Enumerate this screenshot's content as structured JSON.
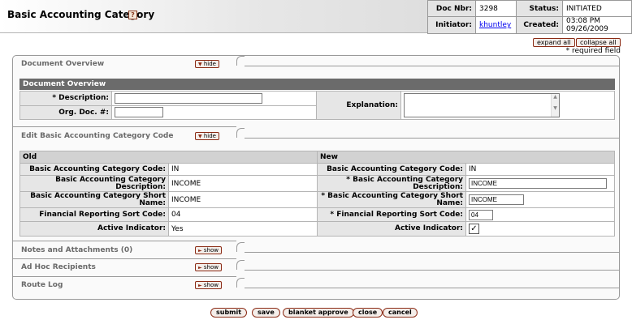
{
  "header": {
    "title": "Basic Accounting Category",
    "help_icon": "?",
    "doc_nbr_label": "Doc Nbr:",
    "doc_nbr": "3298",
    "status_label": "Status:",
    "status": "INITIATED",
    "initiator_label": "Initiator:",
    "initiator": "khuntley",
    "created_label": "Created:",
    "created": "03:08 PM 09/26/2009"
  },
  "toolbar": {
    "expand_all": "expand all",
    "collapse_all": "collapse all",
    "required_note": "* required field"
  },
  "document_overview": {
    "tab_label": "Document Overview",
    "toggle": "hide",
    "section_title": "Document Overview",
    "description_label": "* Description:",
    "description_value": "",
    "org_doc_label": "Org. Doc. #:",
    "org_doc_value": "",
    "explanation_label": "Explanation:",
    "explanation_value": ""
  },
  "edit_section": {
    "tab_label": "Edit Basic Accounting Category Code",
    "toggle": "hide",
    "old_header": "Old",
    "new_header": "New",
    "rows": [
      {
        "label_old": "Basic Accounting Category Code:",
        "old": "IN",
        "label_new": "Basic Accounting Category Code:",
        "new": "IN"
      },
      {
        "label_old": "Basic Accounting Category Description:",
        "old": "INCOME",
        "label_new": "* Basic Accounting Category Description:",
        "new": "INCOME"
      },
      {
        "label_old": "Basic Accounting Category Short Name:",
        "old": "INCOME",
        "label_new": "* Basic Accounting Category Short Name:",
        "new": "INCOME"
      },
      {
        "label_old": "Financial Reporting Sort Code:",
        "old": "04",
        "label_new": "* Financial Reporting Sort Code:",
        "new": "04"
      },
      {
        "label_old": "Active Indicator:",
        "old": "Yes",
        "label_new": "Active Indicator:",
        "new": "✓"
      }
    ]
  },
  "tabs": {
    "notes": {
      "label": "Notes and Attachments (0)",
      "toggle": "show"
    },
    "adhoc": {
      "label": "Ad Hoc Recipients",
      "toggle": "show"
    },
    "route": {
      "label": "Route Log",
      "toggle": "show"
    }
  },
  "actions": {
    "submit": "submit",
    "save": "save",
    "blanket_approve": "blanket approve",
    "close": "close",
    "cancel": "cancel"
  },
  "colors": {
    "button_border": "#8b2b15",
    "section_header": "#6b6b6b"
  }
}
